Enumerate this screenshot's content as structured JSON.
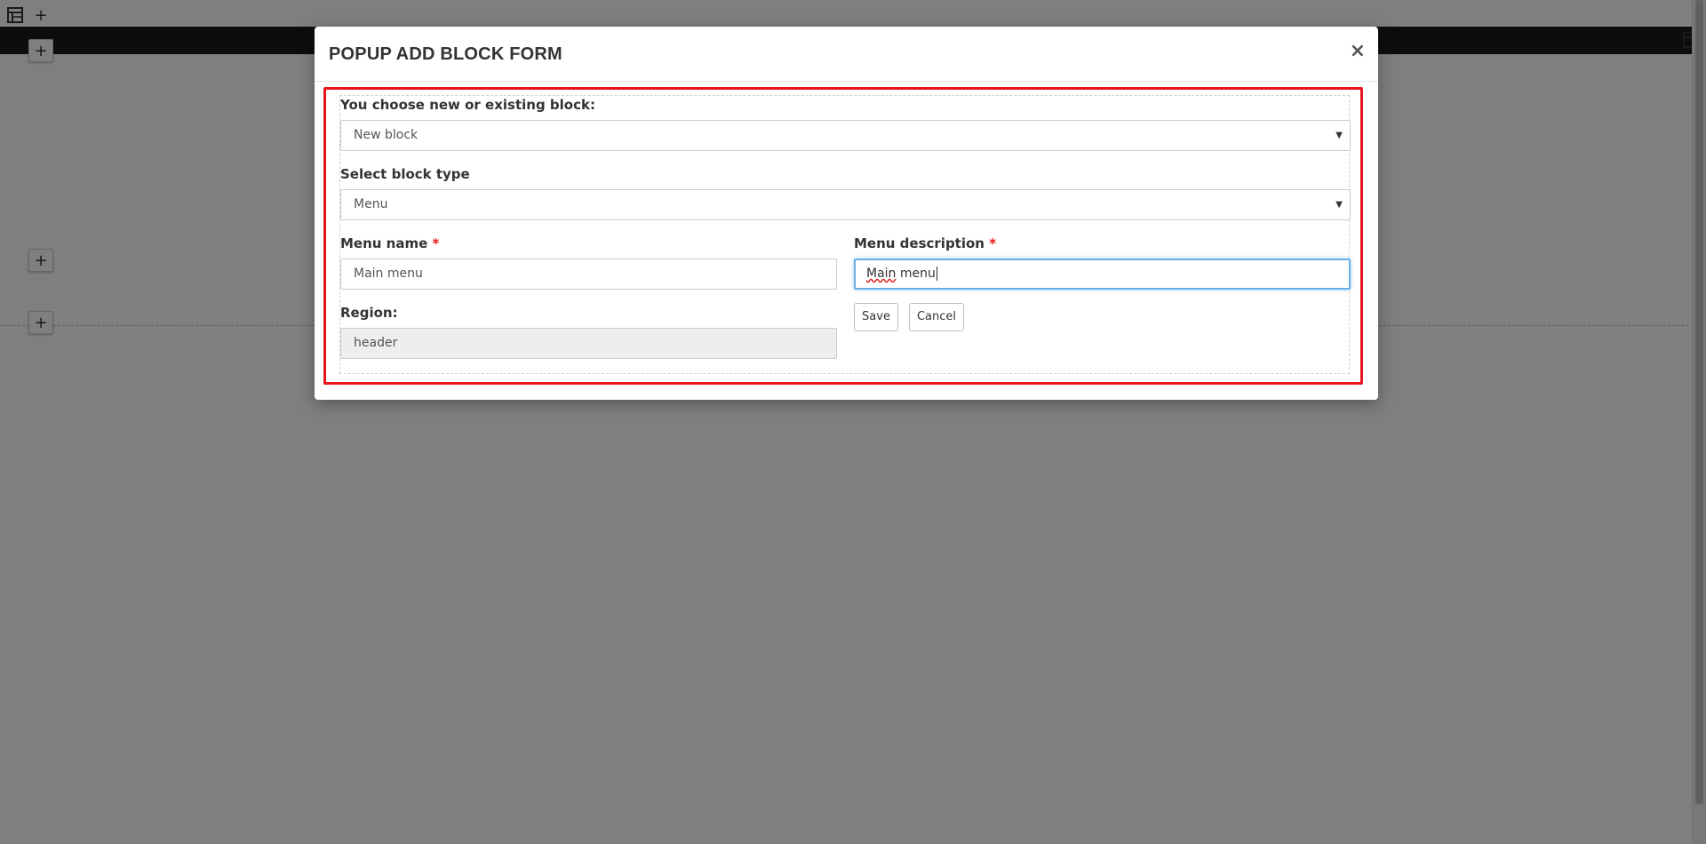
{
  "background": {
    "toolbar_plus": "+",
    "row_plus": "+",
    "section_plus_1": "+",
    "section_plus_2": "+",
    "icons": [
      "table-layout-icon",
      "plus-icon"
    ]
  },
  "modal": {
    "title": "POPUP ADD BLOCK FORM",
    "close": "×",
    "highlight_color": "#e8141b",
    "fields": {
      "block_choice_label": "You choose new or existing block:",
      "block_choice_value": "New block",
      "block_type_label": "Select block type",
      "block_type_value": "Menu",
      "menu_name_label": "Menu name",
      "menu_name_value": "Main menu",
      "menu_description_label": "Menu description",
      "menu_description_value_word1": "Main",
      "menu_description_value_word2": "menu",
      "required_mark": "*",
      "region_label": "Region:",
      "region_value": "header"
    },
    "buttons": {
      "save": "Save",
      "cancel": "Cancel"
    }
  }
}
